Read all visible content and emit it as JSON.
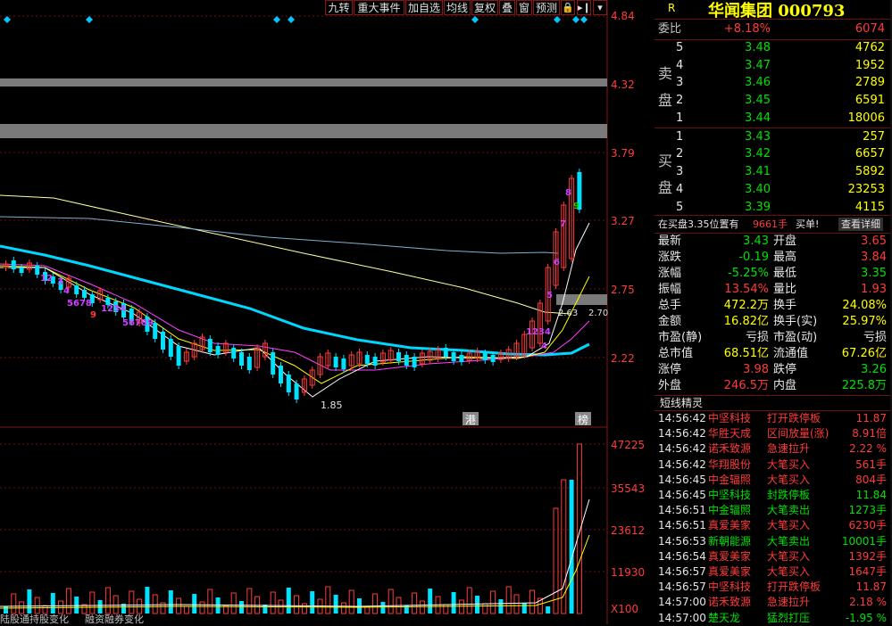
{
  "toolbar": {
    "buttons": [
      "九转",
      "重大事件",
      "加自选",
      "均线",
      "复权",
      "叠",
      "窗",
      "预测"
    ],
    "icons": [
      "lock-icon",
      "arrow-right-icon",
      "chevron-down-icon"
    ]
  },
  "price_axis": [
    "4.84",
    "4.32",
    "3.79",
    "3.27",
    "2.75",
    "2.22"
  ],
  "volume_axis": [
    "47225",
    "35543",
    "23612",
    "11930",
    "X100"
  ],
  "chart_labels": {
    "low_mark": "1.85",
    "high_range": "2.63",
    "high_range2": "2.70",
    "marker_hk": "港",
    "marker_bang": "榜",
    "nine_seq_up": [
      "1",
      "2",
      "3",
      "4",
      "5",
      "6",
      "7",
      "8",
      "9"
    ],
    "nine_seq_down_a": "1234",
    "nine_seq_down_b": "5678",
    "nine_seq_down_c": "9",
    "nine_seq_down_d": "1234",
    "nine_seq_down_e": "56789",
    "nine_seq_early": [
      "1",
      "2",
      "3",
      "4"
    ]
  },
  "bottom_tabs": [
    "陆股通持股变化",
    "融资融券变化"
  ],
  "header": {
    "flag": "R",
    "title": "华闻集团 000793"
  },
  "weibi": {
    "label": "委比",
    "pct": "+8.18%",
    "diff": "6074"
  },
  "sell_label": [
    "卖",
    "盘"
  ],
  "buy_label": [
    "买",
    "盘"
  ],
  "sells": [
    {
      "lvl": "5",
      "price": "3.48",
      "vol": "4762"
    },
    {
      "lvl": "4",
      "price": "3.47",
      "vol": "1952"
    },
    {
      "lvl": "3",
      "price": "3.46",
      "vol": "2789"
    },
    {
      "lvl": "2",
      "price": "3.45",
      "vol": "6591"
    },
    {
      "lvl": "1",
      "price": "3.44",
      "vol": "18006"
    }
  ],
  "buys": [
    {
      "lvl": "1",
      "price": "3.43",
      "vol": "257"
    },
    {
      "lvl": "2",
      "price": "3.42",
      "vol": "6657"
    },
    {
      "lvl": "3",
      "price": "3.41",
      "vol": "5892"
    },
    {
      "lvl": "4",
      "price": "3.40",
      "vol": "23253"
    },
    {
      "lvl": "5",
      "price": "3.39",
      "vol": "4115"
    }
  ],
  "buy_notice": {
    "text": "在买盘3.35位置有",
    "vol": "9661手",
    "action": "买单!",
    "link": "查看详细"
  },
  "stats": [
    {
      "l": "最新",
      "lv": "3.43",
      "lc": "g",
      "r": "开盘",
      "rv": "3.65",
      "rc": "r"
    },
    {
      "l": "涨跌",
      "lv": "-0.19",
      "lc": "g",
      "r": "最高",
      "rv": "3.84",
      "rc": "r"
    },
    {
      "l": "涨幅",
      "lv": "-5.25%",
      "lc": "g",
      "r": "最低",
      "rv": "3.35",
      "rc": "g"
    },
    {
      "l": "振幅",
      "lv": "13.54%",
      "lc": "r",
      "r": "量比",
      "rv": "1.93",
      "rc": "r"
    },
    {
      "l": "总手",
      "lv": "472.2万",
      "lc": "y",
      "r": "换手",
      "rv": "24.08%",
      "rc": "y"
    },
    {
      "l": "金额",
      "lv": "16.82亿",
      "lc": "y",
      "r": "换手(实)",
      "rv": "25.97%",
      "rc": "y"
    },
    {
      "l": "市盈(静)",
      "lv": "亏损",
      "lc": "w",
      "r": "市盈(动)",
      "rv": "亏损",
      "rc": "w"
    },
    {
      "l": "总市值",
      "lv": "68.51亿",
      "lc": "y",
      "r": "流通值",
      "rv": "67.26亿",
      "rc": "y"
    },
    {
      "l": "涨停",
      "lv": "3.98",
      "lc": "r",
      "r": "跌停",
      "rv": "3.26",
      "rc": "g"
    },
    {
      "l": "外盘",
      "lv": "246.5万",
      "lc": "r",
      "r": "内盘",
      "rv": "225.8万",
      "rc": "g"
    }
  ],
  "ticks_title": "短线精灵",
  "ticks": [
    {
      "t": "14:56:42",
      "n": "中坚科技",
      "e": "打开跌停板",
      "v": "11.87",
      "c": "r"
    },
    {
      "t": "14:56:42",
      "n": "华胜天成",
      "e": "区间放量(涨)",
      "v": "8.91倍",
      "c": "r"
    },
    {
      "t": "14:56:42",
      "n": "诺禾致源",
      "e": "急速拉升",
      "v": "2.22 %",
      "c": "r"
    },
    {
      "t": "14:56:42",
      "n": "华翔股份",
      "e": "大笔买入",
      "v": "561手",
      "c": "r"
    },
    {
      "t": "14:56:45",
      "n": "中金辐照",
      "e": "大笔买入",
      "v": "804手",
      "c": "r"
    },
    {
      "t": "14:56:45",
      "n": "中坚科技",
      "e": "封跌停板",
      "v": "11.84",
      "c": "g"
    },
    {
      "t": "14:56:51",
      "n": "中金辐照",
      "e": "大笔卖出",
      "v": "1273手",
      "c": "g"
    },
    {
      "t": "14:56:51",
      "n": "真爱美家",
      "e": "大笔买入",
      "v": "6230手",
      "c": "r"
    },
    {
      "t": "14:56:53",
      "n": "新朝能源",
      "e": "大笔卖出",
      "v": "10001手",
      "c": "g"
    },
    {
      "t": "14:56:54",
      "n": "真爱美家",
      "e": "大笔买入",
      "v": "1392手",
      "c": "r"
    },
    {
      "t": "14:56:57",
      "n": "真爱美家",
      "e": "大笔买入",
      "v": "1647手",
      "c": "r"
    },
    {
      "t": "14:56:57",
      "n": "中坚科技",
      "e": "打开跌停板",
      "v": "11.87",
      "c": "r"
    },
    {
      "t": "14:57:00",
      "n": "诺禾致源",
      "e": "急速拉升",
      "v": "2.18 %",
      "c": "r"
    },
    {
      "t": "14:57:00",
      "n": "楚天龙",
      "e": "猛烈打压",
      "v": "-1.95 %",
      "c": "g"
    }
  ],
  "colors": {
    "up": "#ff3b3b",
    "down": "#00e0ff",
    "ma5": "#ffffff",
    "ma10": "#ffff00",
    "ma20": "#ff40ff",
    "ma60": "#00d7ff",
    "ma120": "#ffffa0",
    "ma250": "#7fb0d0",
    "grid": "#6b1010"
  }
}
